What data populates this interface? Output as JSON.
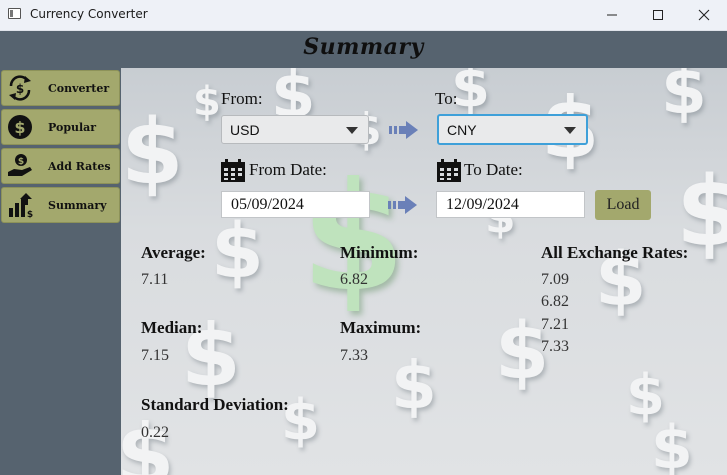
{
  "window": {
    "title": "Currency Converter"
  },
  "header": {
    "title": "Summary"
  },
  "sidebar": {
    "items": [
      {
        "label": "Converter",
        "icon": "currency-exchange-icon"
      },
      {
        "label": "Popular",
        "icon": "dollar-coin-icon"
      },
      {
        "label": "Add Rates",
        "icon": "hand-coin-icon"
      },
      {
        "label": "Summary",
        "icon": "bar-chart-growth-icon"
      }
    ]
  },
  "form": {
    "from_label": "From:",
    "to_label": "To:",
    "from_currency": "USD",
    "to_currency": "CNY",
    "from_date_label": "From Date:",
    "to_date_label": "To Date:",
    "from_date": "05/09/2024",
    "to_date": "12/09/2024",
    "load_label": "Load"
  },
  "stats": {
    "average_label": "Average:",
    "average_value": "7.11",
    "minimum_label": "Minimum:",
    "minimum_value": "6.82",
    "median_label": "Median:",
    "median_value": "7.15",
    "maximum_label": "Maximum:",
    "maximum_value": "7.33",
    "std_label": "Standard Deviation:",
    "std_value": "0.22",
    "rates_label": "All Exchange Rates:",
    "rates": [
      "7.09",
      "6.82",
      "7.21",
      "7.33"
    ]
  },
  "colors": {
    "sidebar_bg": "#56636f",
    "nav_button": "#a3a86d",
    "focus_border": "#3ea0d9",
    "arrow": "#6a80b8"
  }
}
